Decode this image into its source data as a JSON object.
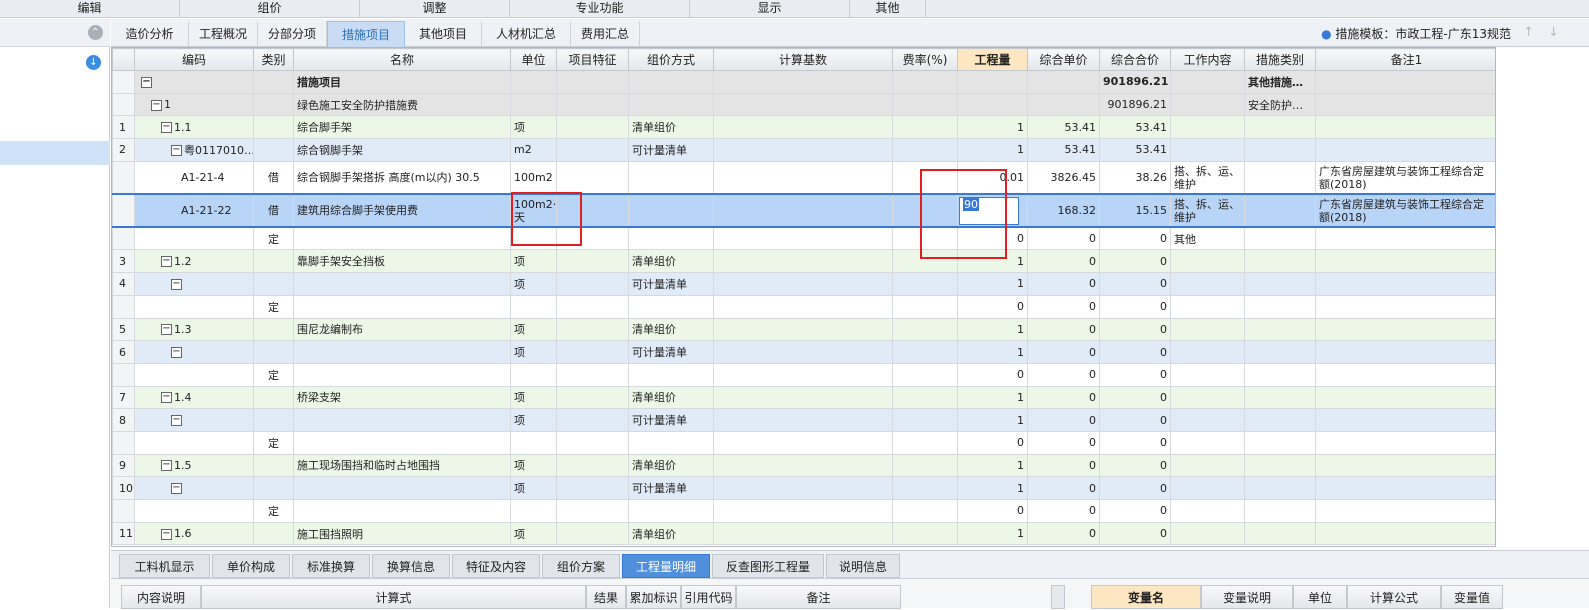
{
  "menu": [
    "编辑",
    "组价",
    "调整",
    "专业功能",
    "显示",
    "其他"
  ],
  "tabs": [
    "造价分析",
    "工程概况",
    "分部分项",
    "措施项目",
    "其他项目",
    "人材机汇总",
    "费用汇总"
  ],
  "active_tab": "措施项目",
  "template_label": "措施模板：市政工程-广东13规范",
  "columns": [
    "编码",
    "类别",
    "名称",
    "单位",
    "项目特征",
    "组价方式",
    "计算基数",
    "费率(%)",
    "工程量",
    "综合单价",
    "综合合价",
    "工作内容",
    "措施类别",
    "备注1"
  ],
  "rows": [
    {
      "rn": "",
      "box": true,
      "indent": 0,
      "code": "",
      "cat": "",
      "name": "措施项目",
      "unit": "",
      "feat": "",
      "method": "",
      "base": "",
      "rate": "",
      "qty": "",
      "uprice": "",
      "total": "901896.21",
      "work": "",
      "mtype": "其他措施…",
      "note": "",
      "style": "gray",
      "bold": true
    },
    {
      "rn": "",
      "box": true,
      "indent": 1,
      "code": "1",
      "cat": "",
      "name": "绿色施工安全防护措施费",
      "unit": "",
      "feat": "",
      "method": "",
      "base": "",
      "rate": "",
      "qty": "",
      "uprice": "",
      "total": "901896.21",
      "work": "",
      "mtype": "安全防护…",
      "note": "",
      "style": "gray"
    },
    {
      "rn": "1",
      "box": true,
      "indent": 2,
      "code": "1.1",
      "cat": "",
      "name": "综合脚手架",
      "unit": "项",
      "feat": "",
      "method": "清单组价",
      "base": "",
      "rate": "",
      "qty": "1",
      "uprice": "53.41",
      "total": "53.41",
      "work": "",
      "mtype": "",
      "note": "",
      "style": "green"
    },
    {
      "rn": "2",
      "box": true,
      "indent": 3,
      "code": "粤0117010…",
      "cat": "",
      "name": "综合钢脚手架",
      "unit": "m2",
      "feat": "",
      "method": "可计量清单",
      "base": "",
      "rate": "",
      "qty": "1",
      "uprice": "53.41",
      "total": "53.41",
      "work": "",
      "mtype": "",
      "note": "",
      "style": "blue"
    },
    {
      "rn": "",
      "box": false,
      "indent": 4,
      "code": "A1-21-4",
      "cat": "借",
      "name": "综合钢脚手架搭拆 高度(m以内) 30.5",
      "unit": "100m2",
      "feat": "",
      "method": "",
      "base": "",
      "rate": "",
      "qty": "0.01",
      "uprice": "3826.45",
      "total": "38.26",
      "work": "搭、拆、运、维护",
      "mtype": "",
      "note": "广东省房屋建筑与装饰工程综合定额(2018)",
      "style": "white",
      "tall": true
    },
    {
      "rn": "",
      "box": false,
      "indent": 4,
      "code": "A1-21-22",
      "cat": "借",
      "name": "建筑用综合脚手架使用费",
      "unit": "100m2·10天",
      "feat": "",
      "method": "",
      "base": "",
      "rate": "",
      "qty": "90",
      "uprice": "168.32",
      "total": "15.15",
      "work": "搭、拆、运、维护",
      "mtype": "",
      "note": "广东省房屋建筑与装饰工程综合定额(2018)",
      "style": "sel",
      "tall": true,
      "editing": true
    },
    {
      "rn": "",
      "box": false,
      "indent": 4,
      "code": "",
      "cat": "定",
      "name": "",
      "unit": "",
      "feat": "",
      "method": "",
      "base": "",
      "rate": "",
      "qty": "0",
      "uprice": "0",
      "total": "0",
      "work": "其他",
      "mtype": "",
      "note": "",
      "style": "white"
    },
    {
      "rn": "3",
      "box": true,
      "indent": 2,
      "code": "1.2",
      "cat": "",
      "name": "靠脚手架安全挡板",
      "unit": "项",
      "feat": "",
      "method": "清单组价",
      "base": "",
      "rate": "",
      "qty": "1",
      "uprice": "0",
      "total": "0",
      "work": "",
      "mtype": "",
      "note": "",
      "style": "green"
    },
    {
      "rn": "4",
      "box": true,
      "indent": 3,
      "code": "",
      "cat": "",
      "name": "",
      "unit": "项",
      "feat": "",
      "method": "可计量清单",
      "base": "",
      "rate": "",
      "qty": "1",
      "uprice": "0",
      "total": "0",
      "work": "",
      "mtype": "",
      "note": "",
      "style": "blue"
    },
    {
      "rn": "",
      "box": false,
      "indent": 4,
      "code": "",
      "cat": "定",
      "name": "",
      "unit": "",
      "feat": "",
      "method": "",
      "base": "",
      "rate": "",
      "qty": "0",
      "uprice": "0",
      "total": "0",
      "work": "",
      "mtype": "",
      "note": "",
      "style": "white"
    },
    {
      "rn": "5",
      "box": true,
      "indent": 2,
      "code": "1.3",
      "cat": "",
      "name": "围尼龙编制布",
      "unit": "项",
      "feat": "",
      "method": "清单组价",
      "base": "",
      "rate": "",
      "qty": "1",
      "uprice": "0",
      "total": "0",
      "work": "",
      "mtype": "",
      "note": "",
      "style": "green"
    },
    {
      "rn": "6",
      "box": true,
      "indent": 3,
      "code": "",
      "cat": "",
      "name": "",
      "unit": "项",
      "feat": "",
      "method": "可计量清单",
      "base": "",
      "rate": "",
      "qty": "1",
      "uprice": "0",
      "total": "0",
      "work": "",
      "mtype": "",
      "note": "",
      "style": "blue"
    },
    {
      "rn": "",
      "box": false,
      "indent": 4,
      "code": "",
      "cat": "定",
      "name": "",
      "unit": "",
      "feat": "",
      "method": "",
      "base": "",
      "rate": "",
      "qty": "0",
      "uprice": "0",
      "total": "0",
      "work": "",
      "mtype": "",
      "note": "",
      "style": "white"
    },
    {
      "rn": "7",
      "box": true,
      "indent": 2,
      "code": "1.4",
      "cat": "",
      "name": "桥梁支架",
      "unit": "项",
      "feat": "",
      "method": "清单组价",
      "base": "",
      "rate": "",
      "qty": "1",
      "uprice": "0",
      "total": "0",
      "work": "",
      "mtype": "",
      "note": "",
      "style": "green"
    },
    {
      "rn": "8",
      "box": true,
      "indent": 3,
      "code": "",
      "cat": "",
      "name": "",
      "unit": "项",
      "feat": "",
      "method": "可计量清单",
      "base": "",
      "rate": "",
      "qty": "1",
      "uprice": "0",
      "total": "0",
      "work": "",
      "mtype": "",
      "note": "",
      "style": "blue"
    },
    {
      "rn": "",
      "box": false,
      "indent": 4,
      "code": "",
      "cat": "定",
      "name": "",
      "unit": "",
      "feat": "",
      "method": "",
      "base": "",
      "rate": "",
      "qty": "0",
      "uprice": "0",
      "total": "0",
      "work": "",
      "mtype": "",
      "note": "",
      "style": "white"
    },
    {
      "rn": "9",
      "box": true,
      "indent": 2,
      "code": "1.5",
      "cat": "",
      "name": "施工现场围挡和临时占地围挡",
      "unit": "项",
      "feat": "",
      "method": "清单组价",
      "base": "",
      "rate": "",
      "qty": "1",
      "uprice": "0",
      "total": "0",
      "work": "",
      "mtype": "",
      "note": "",
      "style": "green"
    },
    {
      "rn": "10",
      "box": true,
      "indent": 3,
      "code": "",
      "cat": "",
      "name": "",
      "unit": "项",
      "feat": "",
      "method": "可计量清单",
      "base": "",
      "rate": "",
      "qty": "1",
      "uprice": "0",
      "total": "0",
      "work": "",
      "mtype": "",
      "note": "",
      "style": "blue"
    },
    {
      "rn": "",
      "box": false,
      "indent": 4,
      "code": "",
      "cat": "定",
      "name": "",
      "unit": "",
      "feat": "",
      "method": "",
      "base": "",
      "rate": "",
      "qty": "0",
      "uprice": "0",
      "total": "0",
      "work": "",
      "mtype": "",
      "note": "",
      "style": "white"
    },
    {
      "rn": "11",
      "box": true,
      "indent": 2,
      "code": "1.6",
      "cat": "",
      "name": "施工围挡照明",
      "unit": "项",
      "feat": "",
      "method": "清单组价",
      "base": "",
      "rate": "",
      "qty": "1",
      "uprice": "0",
      "total": "0",
      "work": "",
      "mtype": "",
      "note": "",
      "style": "green"
    }
  ],
  "bottom_tabs": [
    "工料机显示",
    "单价构成",
    "标准换算",
    "换算信息",
    "特征及内容",
    "组价方案",
    "工程量明细",
    "反查图形工程量",
    "说明信息"
  ],
  "active_bottom_tab": "工程量明细",
  "bottom_left_headers": [
    "内容说明",
    "计算式",
    "结果",
    "累加标识",
    "引用代码",
    "备注"
  ],
  "bottom_right_headers": [
    "变量名",
    "变量说明",
    "单位",
    "计算公式",
    "变量值"
  ],
  "colors": {
    "accent": "#3a78d8",
    "highlight": "#e02020"
  }
}
